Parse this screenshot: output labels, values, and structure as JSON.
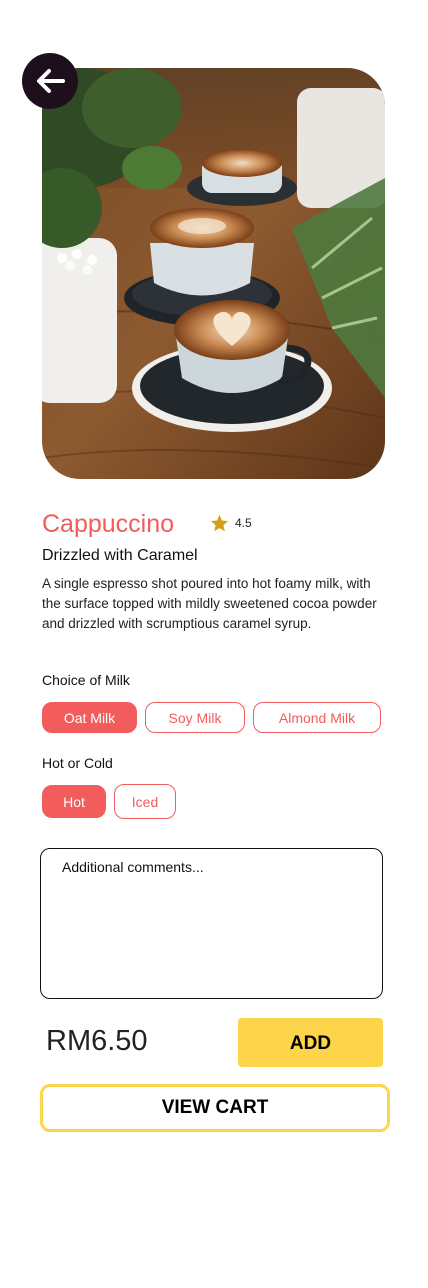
{
  "product": {
    "image_alt": "Three cups of latte art coffee on saucers on a wooden table with potted plants",
    "name": "Cappuccino",
    "rating": "4.5",
    "subtitle": "Drizzled with Caramel",
    "description": "A single espresso shot poured into hot foamy milk, with the surface topped with mildly sweetened cocoa powder and drizzled with scrumptious caramel syrup."
  },
  "options": {
    "milk": {
      "label": "Choice of Milk",
      "choices": [
        "Oat Milk",
        "Soy Milk",
        "Almond Milk"
      ],
      "selected": "Oat Milk"
    },
    "temperature": {
      "label": "Hot or Cold",
      "choices": [
        "Hot",
        "Iced"
      ],
      "selected": "Hot"
    }
  },
  "comments": {
    "placeholder": "Additional comments...",
    "value": ""
  },
  "footer": {
    "price": "RM6.50",
    "add_label": "ADD",
    "view_cart_label": "VIEW CART"
  },
  "colors": {
    "accent": "#f25c5c",
    "button_yellow": "#fcd54b",
    "back_button": "#1e0f1c",
    "star": "#d4a017"
  },
  "icons": {
    "back": "arrow-left-icon",
    "rating": "star-icon"
  }
}
